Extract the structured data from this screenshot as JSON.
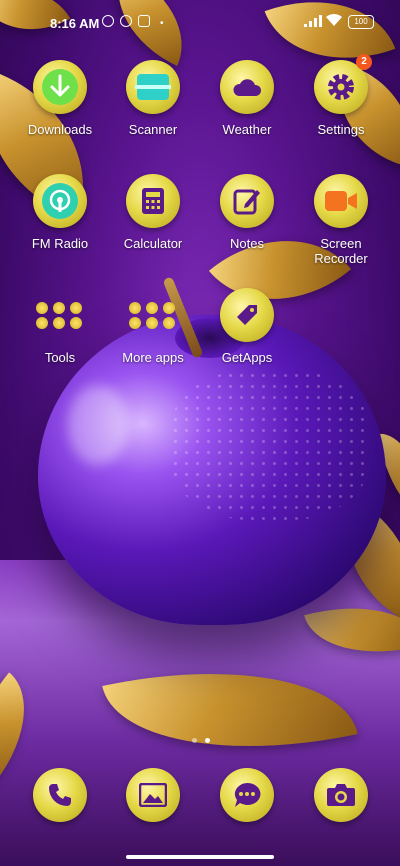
{
  "status_bar": {
    "time": "8:16 AM",
    "battery": "100"
  },
  "apps_row1": [
    {
      "label": "Downloads",
      "icon": "download-icon"
    },
    {
      "label": "Scanner",
      "icon": "scanner-icon"
    },
    {
      "label": "Weather",
      "icon": "weather-icon"
    },
    {
      "label": "Settings",
      "icon": "gear-icon",
      "badge": "2"
    }
  ],
  "apps_row2": [
    {
      "label": "FM Radio",
      "icon": "radio-icon"
    },
    {
      "label": "Calculator",
      "icon": "calculator-icon"
    },
    {
      "label": "Notes",
      "icon": "notes-icon"
    },
    {
      "label": "Screen Recorder",
      "icon": "screen-recorder-icon"
    }
  ],
  "apps_row3": [
    {
      "label": "Tools",
      "icon": "folder-icon"
    },
    {
      "label": "More apps",
      "icon": "folder-icon"
    },
    {
      "label": "GetApps",
      "icon": "getapps-icon"
    }
  ],
  "dock": [
    {
      "label": "Phone",
      "icon": "phone-icon"
    },
    {
      "label": "Gallery",
      "icon": "gallery-icon"
    },
    {
      "label": "Messages",
      "icon": "message-icon"
    },
    {
      "label": "Camera",
      "icon": "camera-icon"
    }
  ],
  "colors": {
    "icon_bg": "#e5d948",
    "icon_fg": "#5a1a8a",
    "badge": "#f4581e",
    "download_green": "#6ee04a",
    "radio_teal": "#2fd0b0",
    "recorder_orange": "#f4731e"
  }
}
